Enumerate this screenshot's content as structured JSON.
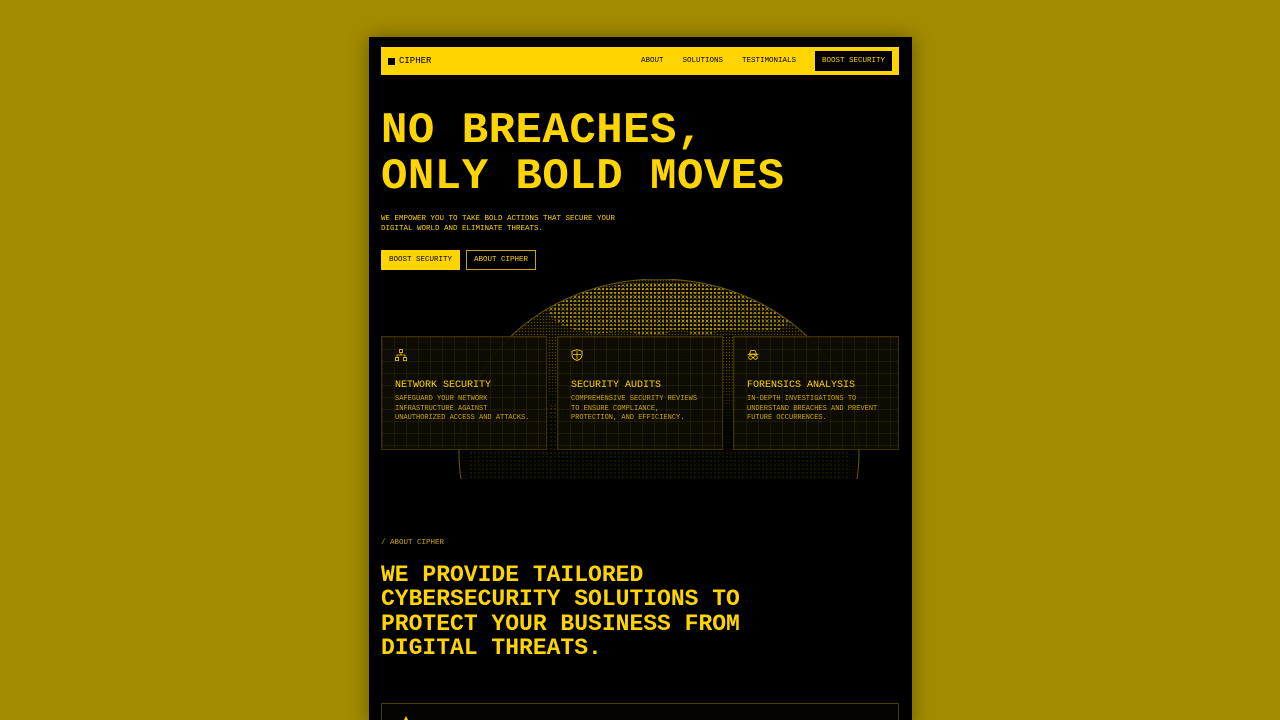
{
  "nav": {
    "logo": "CIPHER",
    "links": [
      "ABOUT",
      "SOLUTIONS",
      "TESTIMONIALS"
    ],
    "cta": "BOOST SECURITY"
  },
  "hero": {
    "title": "NO BREACHES,\nONLY BOLD MOVES",
    "subtitle": "WE EMPOWER YOU TO TAKE BOLD ACTIONS THAT SECURE YOUR DIGITAL WORLD AND ELIMINATE THREATS.",
    "primary_button": "BOOST SECURITY",
    "secondary_button": "ABOUT CIPHER"
  },
  "cards": [
    {
      "icon": "network-icon",
      "title": "NETWORK SECURITY",
      "desc": "SAFEGUARD YOUR NETWORK INFRASTRUCTURE AGAINST UNAUTHORIZED ACCESS AND ATTACKS."
    },
    {
      "icon": "shield-icon",
      "title": "SECURITY AUDITS",
      "desc": "COMPREHENSIVE SECURITY REVIEWS TO ENSURE COMPLIANCE, PROTECTION, AND EFFICIENCY."
    },
    {
      "icon": "spy-icon",
      "title": "FORENSICS ANALYSIS",
      "desc": "IN-DEPTH INVESTIGATIONS TO UNDERSTAND BREACHES AND PREVENT FUTURE OCCURRENCES."
    }
  ],
  "about": {
    "tag": "/ ABOUT CIPHER",
    "title": "WE PROVIDE TAILORED\nCYBERSECURITY SOLUTIONS TO\nPROTECT YOUR BUSINESS FROM\nDIGITAL THREATS."
  },
  "colors": {
    "page_background": "#a38b00",
    "accent": "#ffd500",
    "surface": "#000000"
  }
}
